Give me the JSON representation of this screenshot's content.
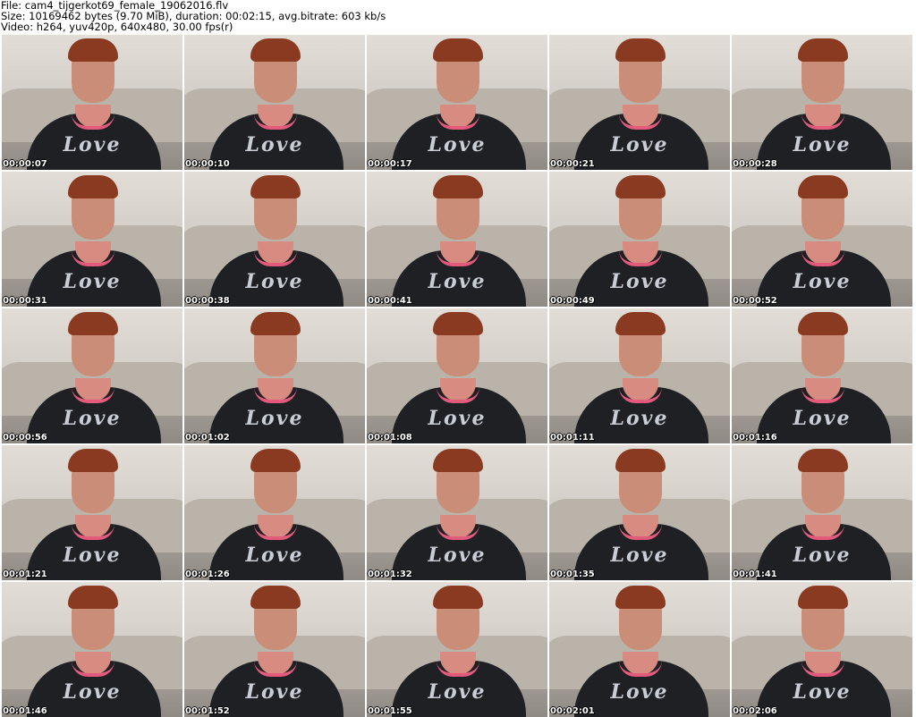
{
  "header": {
    "file_line": "File: cam4_tijgerkot69_female_19062016.flv",
    "size_line": "Size: 10169462 bytes (9.70 MiB), duration: 00:02:15, avg.bitrate: 603 kb/s",
    "video_line": "Video: h264, yuv420p, 640x480, 30.00 fps(r)"
  },
  "thumbnails": {
    "shirt_text": "Love",
    "timestamps": [
      "00:00:07",
      "00:00:10",
      "00:00:17",
      "00:00:21",
      "00:00:28",
      "00:00:31",
      "00:00:38",
      "00:00:41",
      "00:00:49",
      "00:00:52",
      "00:00:56",
      "00:01:02",
      "00:01:08",
      "00:01:11",
      "00:01:16",
      "00:01:21",
      "00:01:26",
      "00:01:32",
      "00:01:35",
      "00:01:41",
      "00:01:46",
      "00:01:52",
      "00:01:55",
      "00:02:01",
      "00:02:06"
    ]
  }
}
